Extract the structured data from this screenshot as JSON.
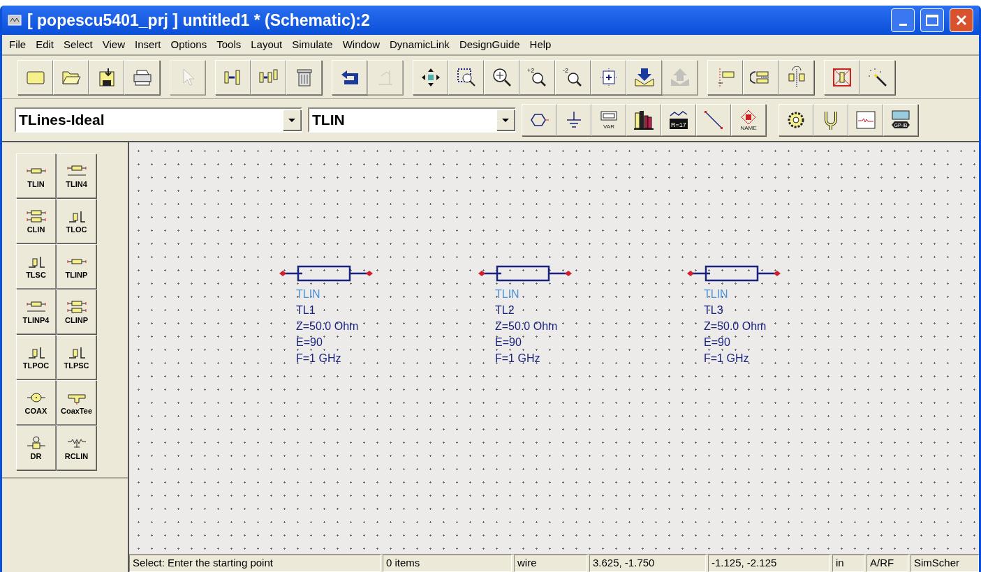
{
  "window": {
    "title": "[ popescu5401_prj ] untitled1 * (Schematic):2"
  },
  "menu": [
    "File",
    "Edit",
    "Select",
    "View",
    "Insert",
    "Options",
    "Tools",
    "Layout",
    "Simulate",
    "Window",
    "DynamicLink",
    "DesignGuide",
    "Help"
  ],
  "toolbar": [
    [
      {
        "kind": "new",
        "disabled": false
      },
      {
        "kind": "open",
        "disabled": false
      },
      {
        "kind": "save",
        "disabled": false
      },
      {
        "kind": "print",
        "disabled": false
      }
    ],
    [
      {
        "kind": "pointer",
        "disabled": true
      }
    ],
    [
      {
        "kind": "copy",
        "disabled": false
      },
      {
        "kind": "copy-multi",
        "disabled": false
      },
      {
        "kind": "trash",
        "disabled": false
      }
    ],
    [
      {
        "kind": "undo",
        "disabled": false
      },
      {
        "kind": "edit",
        "disabled": true
      }
    ],
    [
      {
        "kind": "move",
        "disabled": false
      },
      {
        "kind": "zoom-area",
        "disabled": false
      },
      {
        "kind": "zoom-in",
        "disabled": false
      },
      {
        "kind": "zoom",
        "label": "+2",
        "disabled": false
      },
      {
        "kind": "zoom",
        "label": "-2",
        "disabled": false
      },
      {
        "kind": "fit",
        "disabled": false
      },
      {
        "kind": "push",
        "disabled": false
      },
      {
        "kind": "pop",
        "disabled": true
      }
    ],
    [
      {
        "kind": "mirror",
        "disabled": false
      },
      {
        "kind": "rotate",
        "disabled": false
      },
      {
        "kind": "flip",
        "disabled": false
      }
    ],
    [
      {
        "kind": "deactivate",
        "disabled": false
      },
      {
        "kind": "wand",
        "disabled": false
      }
    ]
  ],
  "library": {
    "value": "TLines-Ideal"
  },
  "component": {
    "value": "TLIN"
  },
  "toolbar2": [
    [
      {
        "kind": "port"
      },
      {
        "kind": "ground"
      },
      {
        "kind": "var",
        "label": "VAR"
      },
      {
        "kind": "books"
      },
      {
        "kind": "display",
        "label": "R=17"
      },
      {
        "kind": "wire"
      },
      {
        "kind": "name",
        "label": "NAME"
      }
    ],
    [
      {
        "kind": "gear"
      },
      {
        "kind": "fork"
      },
      {
        "kind": "scope"
      },
      {
        "kind": "gpib",
        "label": "GP-IB"
      }
    ]
  ],
  "palette": [
    {
      "kind": "tlin",
      "label": "TLIN"
    },
    {
      "kind": "tlin4",
      "label": "TLIN4"
    },
    {
      "kind": "clin",
      "label": "CLIN"
    },
    {
      "kind": "stub",
      "label": "TLOC"
    },
    {
      "kind": "stub",
      "label": "TLSC"
    },
    {
      "kind": "tlin",
      "label": "TLINP"
    },
    {
      "kind": "tlin4",
      "label": "TLINP4"
    },
    {
      "kind": "clin",
      "label": "CLINP"
    },
    {
      "kind": "stub",
      "label": "TLPOC"
    },
    {
      "kind": "stub",
      "label": "TLPSC"
    },
    {
      "kind": "coax",
      "label": "COAX"
    },
    {
      "kind": "tee",
      "label": "CoaxTee"
    },
    {
      "kind": "dr",
      "label": "DR"
    },
    {
      "kind": "rclin",
      "label": "RCLIN"
    }
  ],
  "schematic": [
    {
      "type": "TLIN",
      "name": "TL1",
      "params": [
        "Z=50.0 Ohm",
        "E=90",
        "F=1 GHz"
      ]
    },
    {
      "type": "TLIN",
      "name": "TL2",
      "params": [
        "Z=50.0 Ohm",
        "E=90",
        "F=1 GHz"
      ]
    },
    {
      "type": "TLIN",
      "name": "TL3",
      "params": [
        "Z=50.0 Ohm",
        "E=90",
        "F=1 GHz"
      ]
    }
  ],
  "status_bar": {
    "prompt": "Select: Enter the starting point",
    "items": "0 items",
    "mode": "wire",
    "cursor": "3.625, -1.750",
    "relative": "-1.125, -2.125",
    "units": "in",
    "simulator": "A/RF",
    "name": "SimScher"
  }
}
